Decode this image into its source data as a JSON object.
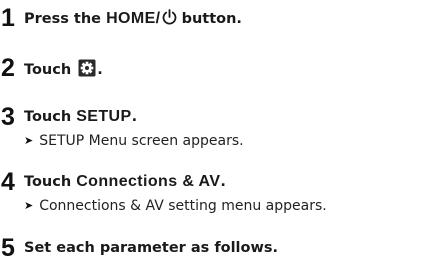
{
  "steps": [
    {
      "number": "1",
      "text_before": "Press the ",
      "key": "HOME",
      "separator": "/",
      "icon": "power-icon",
      "text_after": " button."
    },
    {
      "number": "2",
      "text_before": "Touch ",
      "icon": "gear-icon",
      "text_after": "."
    },
    {
      "number": "3",
      "text_before": "Touch ",
      "key": "SETUP",
      "text_after": ".",
      "result_arrow": "➤",
      "result": "SETUP Menu screen appears."
    },
    {
      "number": "4",
      "text_before": "Touch ",
      "key": "Connections & AV",
      "text_after": ".",
      "result_arrow": "➤",
      "result": "Connections & AV setting menu appears."
    },
    {
      "number": "5",
      "text": "Set each parameter as follows."
    }
  ]
}
